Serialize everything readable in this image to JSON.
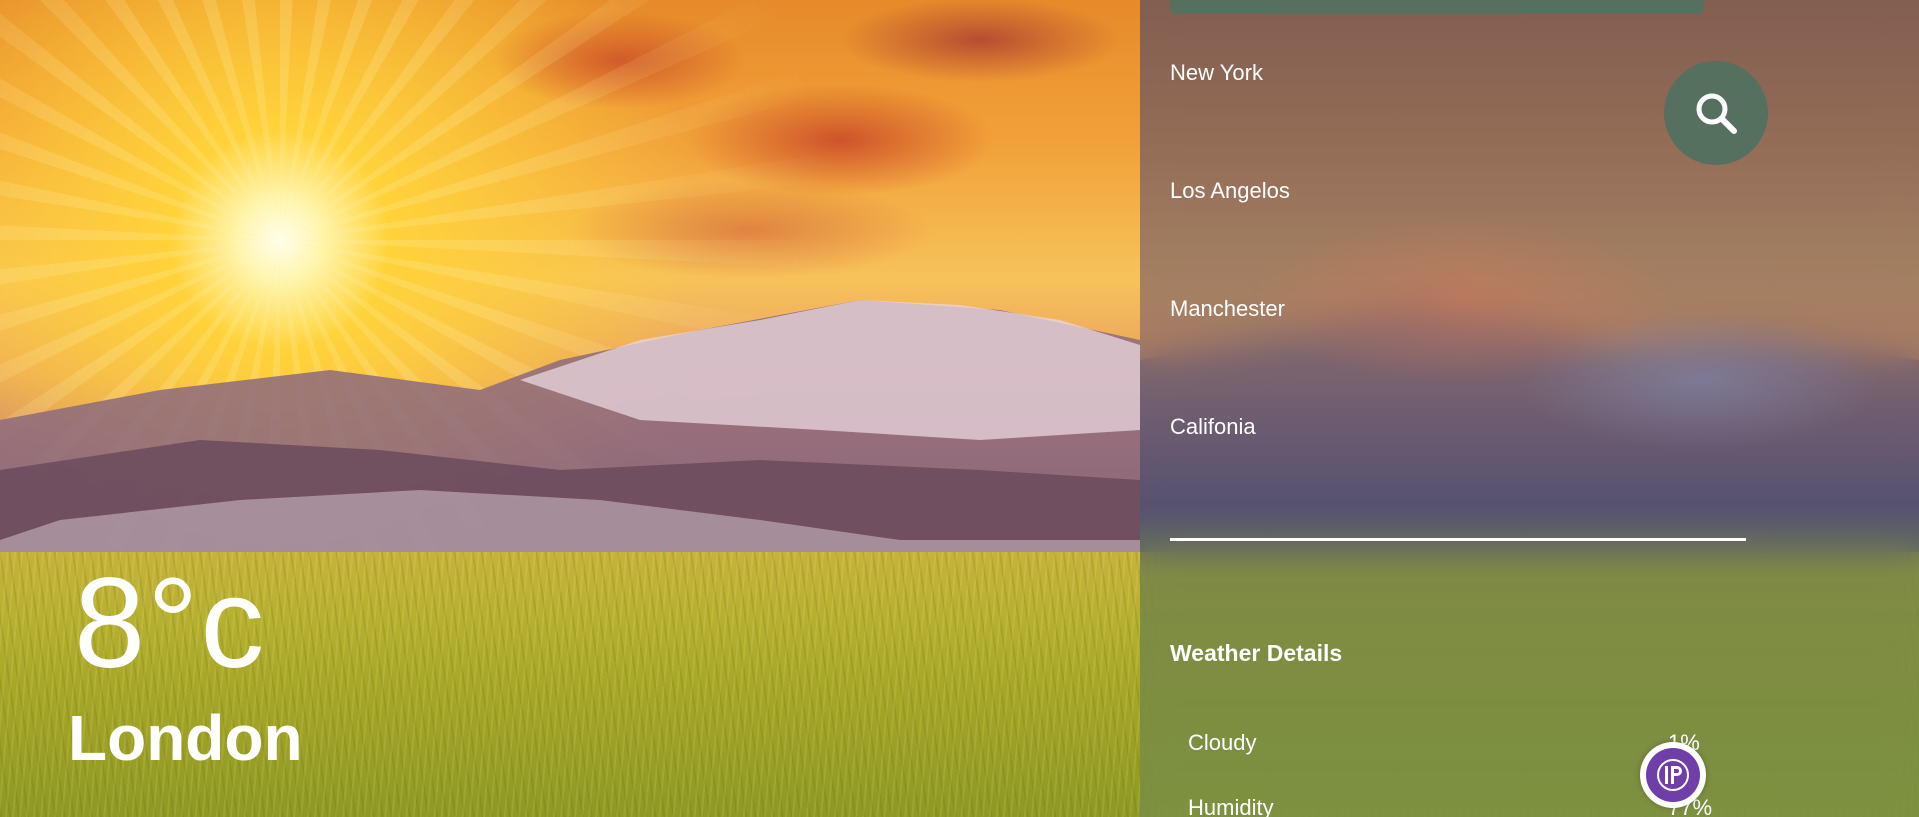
{
  "weather": {
    "temperature": "8°c",
    "city": "London"
  },
  "search": {
    "icon": "search-icon",
    "accent_color": "#55705e"
  },
  "locations": [
    {
      "label": "New York"
    },
    {
      "label": "Los Angelos"
    },
    {
      "label": "Manchester"
    },
    {
      "label": "Califonia"
    }
  ],
  "details": {
    "title": "Weather Details",
    "rows": [
      {
        "label": "Cloudy",
        "value": "1%"
      },
      {
        "label": "Humidity",
        "value": "77%"
      }
    ]
  },
  "badge": {
    "icon": "ip-logo-icon",
    "color": "#6f3ea8"
  }
}
